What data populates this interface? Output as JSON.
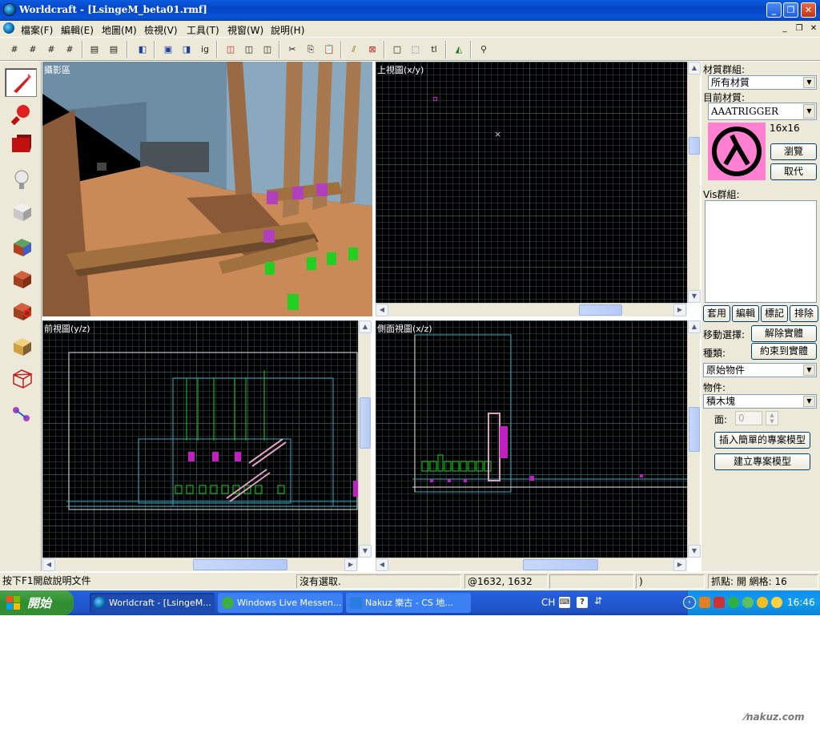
{
  "window": {
    "title": "Worldcraft - [LsingeM_beta01.rmf]",
    "controls": [
      "_",
      "❐",
      "✕"
    ]
  },
  "menu": {
    "items": [
      "檔案(F)",
      "編輯(E)",
      "地圖(M)",
      "檢視(V)",
      "工具(T)",
      "視窗(W)",
      "說明(H)"
    ],
    "mdi_controls": [
      "_",
      "❐",
      "✕"
    ]
  },
  "viewports": {
    "camera": "攝影區",
    "top": "上視圖(x/y)",
    "front": "前視圖(y/z)",
    "side": "側面視圖(x/z)"
  },
  "right_panel": {
    "texture_group_label": "材質群組:",
    "texture_group_value": "所有材質",
    "current_texture_label": "目前材質:",
    "current_texture_value": "AAATRIGGER",
    "texture_size": "16x16",
    "browse_button": "瀏覽",
    "replace_button": "取代",
    "vis_group_label": "Vis群組:",
    "vis_buttons": [
      "套用",
      "編輯",
      "標記",
      "排除"
    ],
    "move_selection_label": "移動選擇:",
    "ungroup_button": "解除實體",
    "type_label": "種類:",
    "tie_to_entity_button": "約束到實體",
    "type_value": "原始物件",
    "object_label": "物件:",
    "object_value": "積木塊",
    "faces_label": "面:",
    "faces_value": "0",
    "insert_prefab_button": "插入簡單的專案模型",
    "create_prefab_button": "建立專案模型"
  },
  "status": {
    "help": "按下F1開啟說明文件",
    "selection": "沒有選取.",
    "coords": "@1632, 1632",
    "extra": ")",
    "snap": "抓點: 開 網格: 16"
  },
  "taskbar": {
    "start": "開始",
    "tasks": [
      "Worldcraft - [LsingeM...",
      "Windows Live Messen...",
      "Nakuz 樂古 - CS 地..."
    ],
    "lang": "CH",
    "clock": "16:46"
  },
  "watermark": "nakuz.com",
  "colors": {
    "titlebar": "#0a5ce0",
    "taskbar": "#245edc",
    "start": "#3c9a3c",
    "viewport_bg": "#000000",
    "brush_blue": "#3aa8c8",
    "entity_magenta": "#c020c0",
    "trigger_green": "#20d020"
  }
}
